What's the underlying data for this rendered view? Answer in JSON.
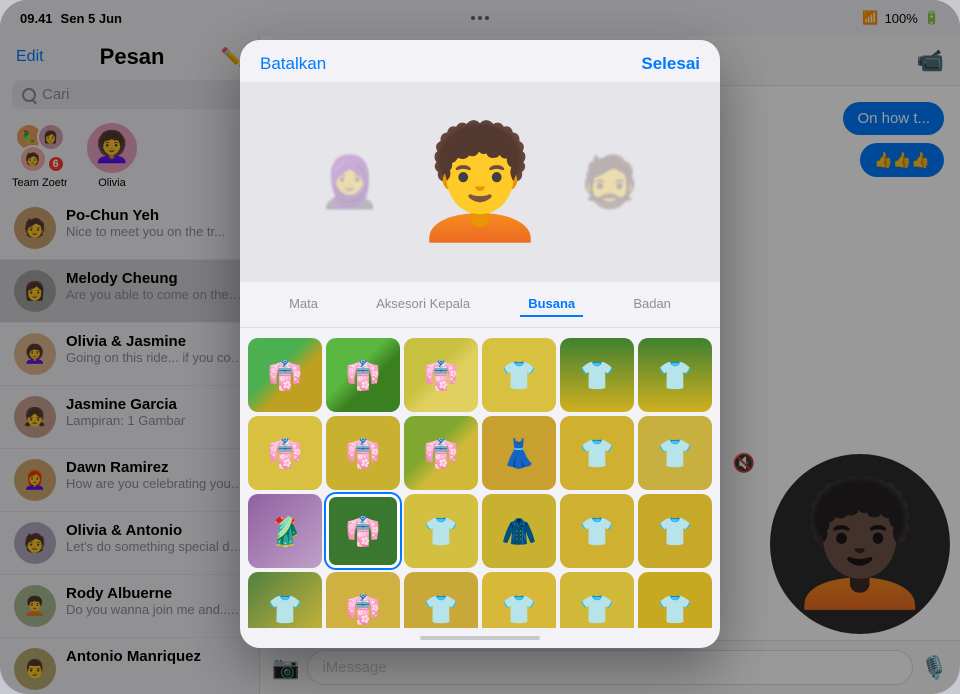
{
  "statusBar": {
    "time": "09.41",
    "day": "Sen 5 Jun",
    "wifi": "WiFi",
    "battery": "100%",
    "dots": [
      "•",
      "•",
      "•"
    ]
  },
  "sidebar": {
    "title": "Pesan",
    "editLabel": "Edit",
    "searchPlaceholder": "Cari",
    "pinnedContacts": [
      {
        "name": "Team Zoetrope",
        "type": "group",
        "badge": "6"
      },
      {
        "name": "Olivia",
        "type": "single",
        "emoji": "👩‍🦱",
        "color": "#f0a0c0"
      }
    ],
    "messages": [
      {
        "name": "Po-Chun Yeh",
        "preview": "Nice to meet you on the tr...",
        "emoji": "🧑",
        "color": "#c0a080"
      },
      {
        "name": "Melody Cheung",
        "preview": "Are you able to come on the ride or not?",
        "emoji": "👩",
        "color": "#a0a0a0",
        "active": true
      },
      {
        "name": "Olivia & Jasmine",
        "preview": "Going on this ride... if you come too you're welcome",
        "emoji": "👩‍🦱",
        "color": "#e8c0a0"
      },
      {
        "name": "Jasmine Garcia",
        "preview": "Lampiran: 1 Gambar",
        "emoji": "👧",
        "color": "#c8a8a0"
      },
      {
        "name": "Dawn Ramirez",
        "preview": "How are you celebrating your big day?",
        "emoji": "👩‍🦰",
        "color": "#d0a880"
      },
      {
        "name": "Olivia & Antonio",
        "preview": "Let's do something special dawn at the next meeting...",
        "emoji": "🧑",
        "color": "#b0a8c0"
      },
      {
        "name": "Rody Albuerne",
        "preview": "Do you wanna join me and... breakfast?",
        "emoji": "🧑‍🦱",
        "color": "#a8b890"
      },
      {
        "name": "Antonio Manriquez",
        "preview": "",
        "emoji": "👨",
        "color": "#b8a870"
      }
    ]
  },
  "chat": {
    "bubbles": [
      "On how t...",
      "👍👍👍"
    ],
    "inputPlaceholder": "iMessage"
  },
  "modal": {
    "cancelLabel": "Batalkan",
    "doneLabel": "Selesai",
    "categories": [
      {
        "label": "Mata",
        "active": false
      },
      {
        "label": "Aksesori Kepala",
        "active": false
      },
      {
        "label": "Busana",
        "active": true
      },
      {
        "label": "Badan",
        "active": false
      }
    ],
    "clothingItems": [
      {
        "bg": "#4caf50",
        "pattern": "circles",
        "emoji": "👘",
        "selected": false
      },
      {
        "bg": "#6acd60",
        "pattern": "zigzag",
        "emoji": "👘",
        "selected": false
      },
      {
        "bg": "#d4c840",
        "pattern": "stripes",
        "emoji": "👘",
        "selected": false
      },
      {
        "bg": "#e8d060",
        "pattern": "plain",
        "emoji": "👕",
        "selected": false
      },
      {
        "bg": "#5c9e40",
        "pattern": "dots",
        "emoji": "👕",
        "selected": false
      },
      {
        "bg": "#5c9e40",
        "pattern": "collar",
        "emoji": "👕",
        "selected": false
      },
      {
        "bg": "#e8c840",
        "pattern": "plain2",
        "emoji": "👘",
        "selected": false
      },
      {
        "bg": "#d4b830",
        "pattern": "plain3",
        "emoji": "👘",
        "selected": false
      },
      {
        "bg": "#8fb840",
        "pattern": "sash",
        "emoji": "👘",
        "selected": false
      },
      {
        "bg": "#d4c040",
        "pattern": "plain4",
        "emoji": "👗",
        "selected": false
      },
      {
        "bg": "#c8a030",
        "pattern": "plain5",
        "emoji": "👕",
        "selected": false
      },
      {
        "bg": "#d4b040",
        "pattern": "plain6",
        "emoji": "👕",
        "selected": false
      },
      {
        "bg": "#9060a0",
        "pattern": "saree",
        "emoji": "🥻",
        "selected": false
      },
      {
        "bg": "#4a8840",
        "pattern": "green-kurta",
        "emoji": "👘",
        "selected": true
      },
      {
        "bg": "#d4c040",
        "pattern": "plain7",
        "emoji": "👕",
        "selected": false
      },
      {
        "bg": "#d4b040",
        "pattern": "jacket",
        "emoji": "🧥",
        "selected": false
      },
      {
        "bg": "#c8b030",
        "pattern": "plain8",
        "emoji": "👕",
        "selected": false
      },
      {
        "bg": "#d0b840",
        "pattern": "plain9",
        "emoji": "👕",
        "selected": false
      },
      {
        "bg": "#c8a830",
        "pattern": "dashiki2",
        "emoji": "👕",
        "selected": false
      },
      {
        "bg": "#5a9040",
        "pattern": "stripe2",
        "emoji": "👘",
        "selected": false
      },
      {
        "bg": "#d0b040",
        "pattern": "plain10",
        "emoji": "👕",
        "selected": false
      },
      {
        "bg": "#c8a030",
        "pattern": "plain11",
        "emoji": "👕",
        "selected": false
      },
      {
        "bg": "#d8c040",
        "pattern": "plain12",
        "emoji": "👕",
        "selected": false
      },
      {
        "bg": "#d0b838",
        "pattern": "plain13",
        "emoji": "👕",
        "selected": false
      }
    ]
  }
}
